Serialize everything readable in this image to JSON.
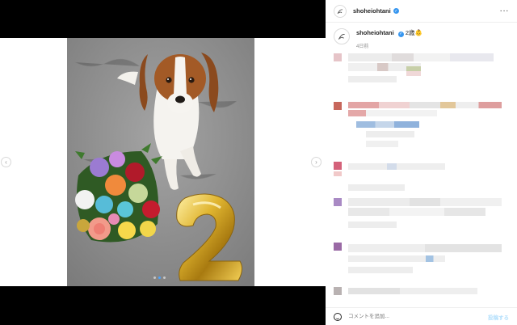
{
  "header": {
    "username": "shoheiohtani",
    "more_icon": "more-horizontal-icon"
  },
  "caption": {
    "username": "shoheiohtani",
    "text": "2歳👶",
    "time": "4日前"
  },
  "composer": {
    "placeholder": "コメントを追加...",
    "post_label": "投稿する"
  },
  "carousel": {
    "slides": 3,
    "active_index": 1
  },
  "colors": {
    "verified": "#3897f0",
    "link": "#b2dffc",
    "text": "#262626",
    "muted": "#8e8e8e"
  }
}
